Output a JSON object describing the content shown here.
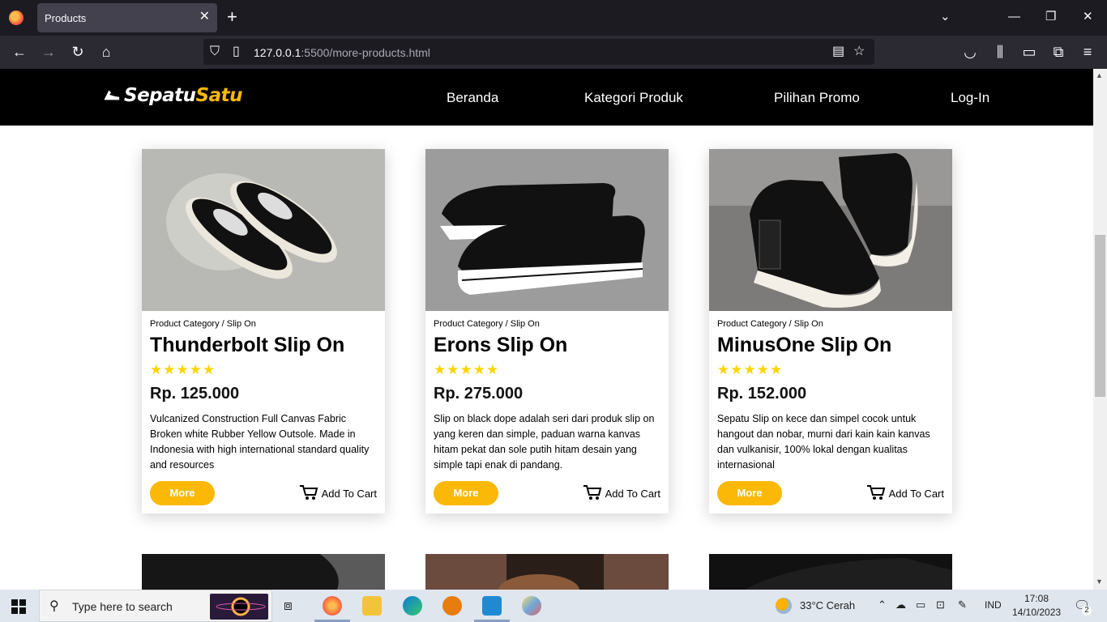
{
  "browser": {
    "tab_title": "Products",
    "url_host": "127.0.0.1",
    "url_rest": ":5500/more-products.html"
  },
  "site": {
    "logo_a": "Sepatu",
    "logo_b": "Satu",
    "menu": [
      "Beranda",
      "Kategori Produk",
      "Pilihan Promo",
      "Log-In"
    ],
    "accent_color": "#fbb806"
  },
  "products": [
    {
      "breadcrumb": "Product Category / Slip On",
      "name": "Thunderbolt Slip On",
      "rating": 5,
      "price": "Rp. 125.000",
      "description": "Vulcanized Construction Full Canvas Fabric Broken white Rubber Yellow Outsole. Made in Indonesia with high international standard quality and resources",
      "more_label": "More",
      "cart_label": "Add To Cart"
    },
    {
      "breadcrumb": "Product Category / Slip On",
      "name": "Erons Slip On",
      "rating": 5,
      "price": "Rp. 275.000",
      "description": "Slip on black dope adalah seri dari produk slip on yang keren dan simple, paduan warna kanvas hitam pekat dan sole putih hitam desain yang simple tapi enak di pandang.",
      "more_label": "More",
      "cart_label": "Add To Cart"
    },
    {
      "breadcrumb": "Product Category / Slip On",
      "name": "MinusOne Slip On",
      "rating": 5,
      "price": "Rp. 152.000",
      "description": "Sepatu Slip on kece dan simpel cocok untuk hangout dan nobar, murni dari kain kain kanvas dan vulkanisir, 100% lokal dengan kualitas internasional",
      "more_label": "More",
      "cart_label": "Add To Cart"
    }
  ],
  "taskbar": {
    "search_placeholder": "Type here to search",
    "weather": "33°C  Cerah",
    "lang": "IND",
    "time": "17:08",
    "date": "14/10/2023",
    "notifications": "2"
  }
}
